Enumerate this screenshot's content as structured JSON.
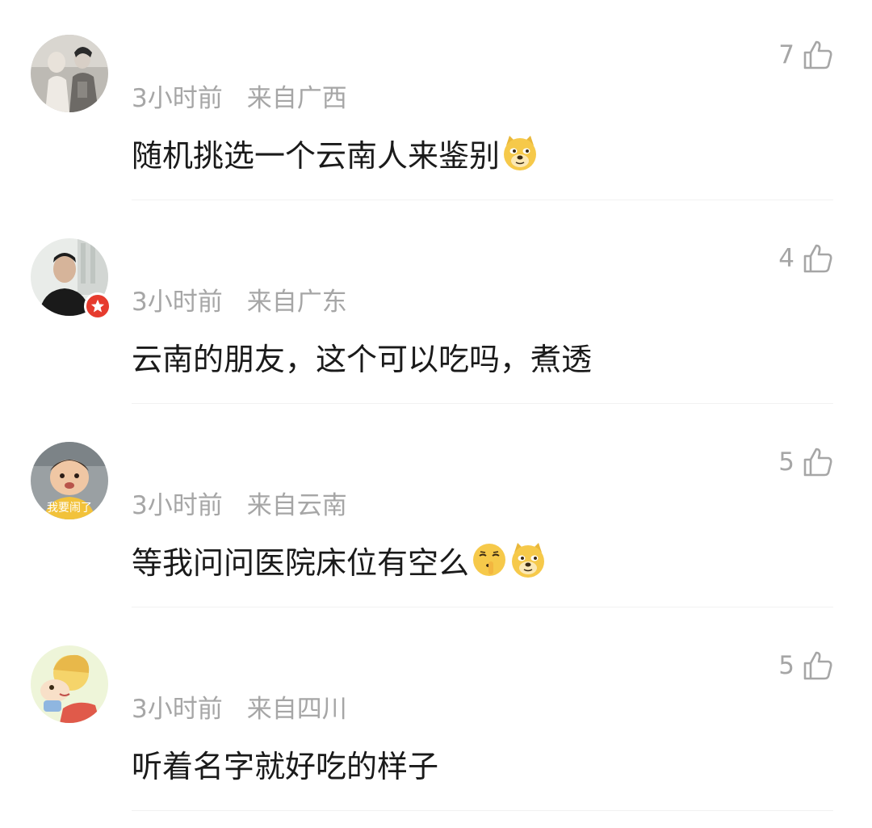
{
  "comments": [
    {
      "time": "3小时前",
      "location": "来自广西",
      "text": "随机挑选一个云南人来鉴别",
      "likes": "7",
      "emojis": [
        "doge-emoji"
      ],
      "verified": false
    },
    {
      "time": "3小时前",
      "location": "来自广东",
      "text": "云南的朋友，这个可以吃吗，煮透",
      "likes": "4",
      "emojis": [],
      "verified": true
    },
    {
      "time": "3小时前",
      "location": "来自云南",
      "text": "等我问问医院床位有空么",
      "likes": "5",
      "emojis": [
        "shush-emoji",
        "doge-emoji"
      ],
      "verified": false,
      "avatar_caption": "我要闹了"
    },
    {
      "time": "3小时前",
      "location": "来自四川",
      "text": "听着名字就好吃的样子",
      "likes": "5",
      "emojis": [],
      "verified": false
    }
  ],
  "icons": {
    "like": "thumbs-up-outline-icon",
    "verified": "star-badge-icon"
  },
  "colors": {
    "meta_text": "#a6a6a6",
    "body_text": "#1a1a1a",
    "badge_red": "#e63b2e",
    "divider": "#f1f1f1",
    "emoji_yellow": "#f6c94a"
  }
}
